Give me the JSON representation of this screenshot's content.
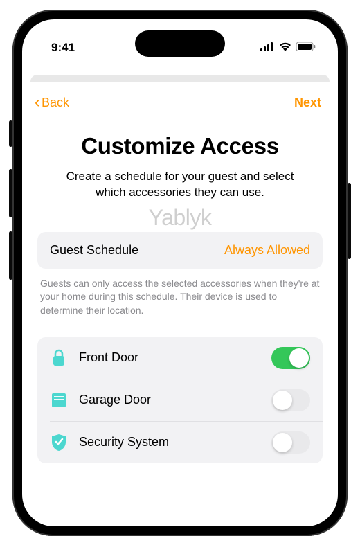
{
  "status_bar": {
    "time": "9:41"
  },
  "nav": {
    "back_label": "Back",
    "next_label": "Next"
  },
  "title": "Customize Access",
  "subtitle": "Create a schedule for your guest and select which accessories they can use.",
  "watermark": "Yablyk",
  "schedule": {
    "label": "Guest Schedule",
    "value": "Always Allowed"
  },
  "help_text": "Guests can only access the selected accessories when they're at your home during this schedule. Their device is used to determine their location.",
  "accessories": [
    {
      "name": "Front Door",
      "icon": "lock",
      "enabled": true
    },
    {
      "name": "Garage Door",
      "icon": "garage",
      "enabled": false
    },
    {
      "name": "Security System",
      "icon": "shield",
      "enabled": false
    }
  ],
  "colors": {
    "accent": "#ff9500",
    "toggle_on": "#34c759",
    "icon_tint": "#4cd7cf"
  }
}
